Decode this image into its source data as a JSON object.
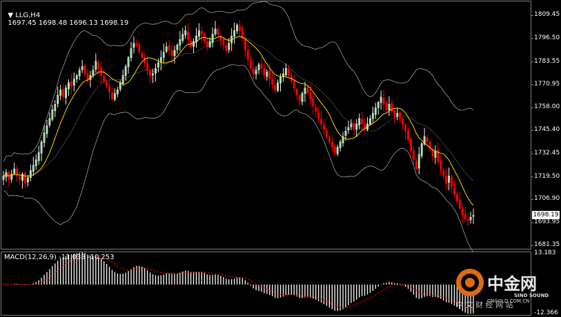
{
  "header": {
    "symbol": "LLG,H4",
    "ohlc": "1697.45 1698.48 1696.13 1698.19"
  },
  "macd_label": "MACD(12,26,9) -11.038 -10.253",
  "current_price": "1698.19",
  "watermark": {
    "brand": "中金网",
    "sound": "SINO SOUND",
    "site": "CNGOLD.COM.CN",
    "tagline": "中 文 财 经 网 站"
  },
  "colors": {
    "up": "#f5f5f5",
    "up_fill": "#98e598",
    "down": "#ff0000",
    "ma": "#ffd700",
    "bands": "#a0a0a0",
    "signal": "#ff0000",
    "hist": "#ffffff",
    "grid_border": "#808080"
  },
  "chart_data": [
    {
      "type": "candlestick",
      "title": "LLG,H4",
      "ohlc_last": [
        1697.45,
        1698.48,
        1696.13,
        1698.19
      ],
      "ylim": [
        1681.35,
        1815.0
      ],
      "y_ticks": [
        "1809.45",
        "1796.50",
        "1783.55",
        "1770.95",
        "1758.00",
        "1745.40",
        "1732.45",
        "1719.50",
        "1706.90",
        "1693.95",
        "1681.35"
      ],
      "close": [
        1720,
        1722,
        1718,
        1721,
        1724,
        1720,
        1718,
        1721,
        1716,
        1719,
        1723,
        1726,
        1729,
        1733,
        1739,
        1744,
        1748,
        1752,
        1757,
        1760,
        1765,
        1768,
        1764,
        1769,
        1772,
        1770,
        1774,
        1776,
        1779,
        1781,
        1777,
        1773,
        1776,
        1779,
        1784,
        1780,
        1776,
        1773,
        1770,
        1767,
        1763,
        1766,
        1768,
        1772,
        1776,
        1781,
        1786,
        1791,
        1794,
        1793,
        1789,
        1786,
        1783,
        1779,
        1776,
        1777,
        1780,
        1783,
        1786,
        1789,
        1792,
        1790,
        1787,
        1790,
        1793,
        1796,
        1799,
        1801,
        1796,
        1792,
        1795,
        1798,
        1801,
        1799,
        1795,
        1792,
        1795,
        1799,
        1802,
        1799,
        1796,
        1793,
        1790,
        1794,
        1798,
        1801,
        1804,
        1801,
        1797,
        1790,
        1785,
        1780,
        1777,
        1779,
        1782,
        1780,
        1776,
        1778,
        1774,
        1771,
        1768,
        1772,
        1775,
        1777,
        1780,
        1776,
        1773,
        1769,
        1765,
        1762,
        1766,
        1769,
        1766,
        1763,
        1759,
        1756,
        1752,
        1749,
        1746,
        1742,
        1739,
        1736,
        1733,
        1736,
        1739,
        1742,
        1745,
        1747,
        1749,
        1746,
        1749,
        1752,
        1749,
        1746,
        1749,
        1752,
        1755,
        1758,
        1761,
        1764,
        1760,
        1757,
        1760,
        1756,
        1753,
        1755,
        1752,
        1749,
        1745,
        1740,
        1734,
        1729,
        1724,
        1732,
        1738,
        1742,
        1739,
        1735,
        1731,
        1734,
        1728,
        1724,
        1720,
        1716,
        1720,
        1714,
        1710,
        1706,
        1702,
        1698,
        1696,
        1695,
        1697,
        1698
      ],
      "ma_period": 10,
      "bollinger": {
        "period": 20,
        "deviations": 2
      }
    },
    {
      "type": "bar",
      "title": "MACD(12,26,9)",
      "macd": -11.038,
      "signal": -10.253,
      "ylim": [
        -12.366,
        13.183
      ],
      "y_ticks": [
        "13.183",
        "-12.366"
      ]
    }
  ]
}
